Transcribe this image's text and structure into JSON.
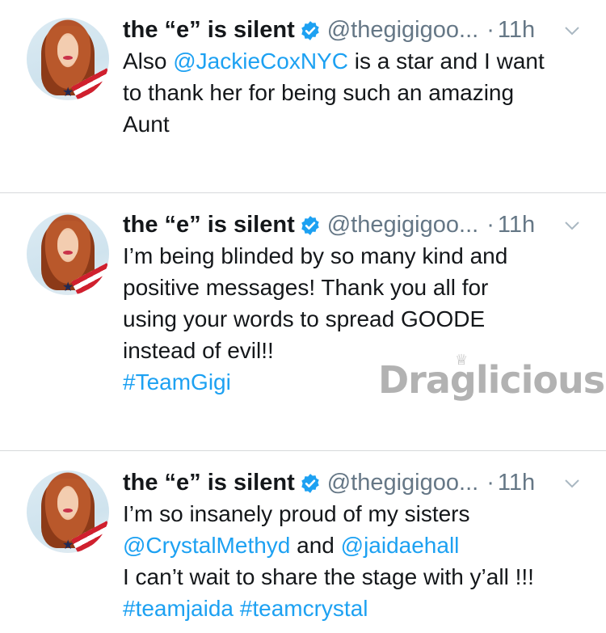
{
  "accent_color": "#1da1f2",
  "tweets": [
    {
      "name": "the “e” is silent",
      "handle": "@thegigigoo...",
      "dot": "·",
      "time": "11h",
      "lines": [
        [
          {
            "t": "Also "
          },
          {
            "t": "@JackieCoxNYC",
            "link": true
          },
          {
            "t": " is a star and I want"
          }
        ],
        [
          {
            "t": "to thank her for being such an amazing"
          }
        ],
        [
          {
            "t": "Aunt"
          }
        ]
      ]
    },
    {
      "name": "the “e” is silent",
      "handle": "@thegigigoo...",
      "dot": "·",
      "time": "11h",
      "lines": [
        [
          {
            "t": "I’m being blinded by so many kind and"
          }
        ],
        [
          {
            "t": "positive messages! Thank you all for"
          }
        ],
        [
          {
            "t": "using your words to spread GOODE"
          }
        ],
        [
          {
            "t": "instead of evil!!"
          }
        ],
        [
          {
            "t": "#TeamGigi",
            "link": true
          }
        ]
      ]
    },
    {
      "name": "the “e” is silent",
      "handle": "@thegigigoo...",
      "dot": "·",
      "time": "11h",
      "lines": [
        [
          {
            "t": "I’m so insanely proud of my sisters"
          }
        ],
        [
          {
            "t": "@CrystalMethyd",
            "link": true
          },
          {
            "t": " and "
          },
          {
            "t": "@jaidaehall",
            "link": true
          }
        ],
        [
          {
            "t": "I can’t wait to share the stage with y’all !!!"
          }
        ],
        [
          {
            "t": "#teamjaida",
            "link": true
          },
          {
            "t": " "
          },
          {
            "t": "#teamcrystal",
            "link": true
          }
        ]
      ]
    }
  ],
  "watermark": "Draglicious"
}
